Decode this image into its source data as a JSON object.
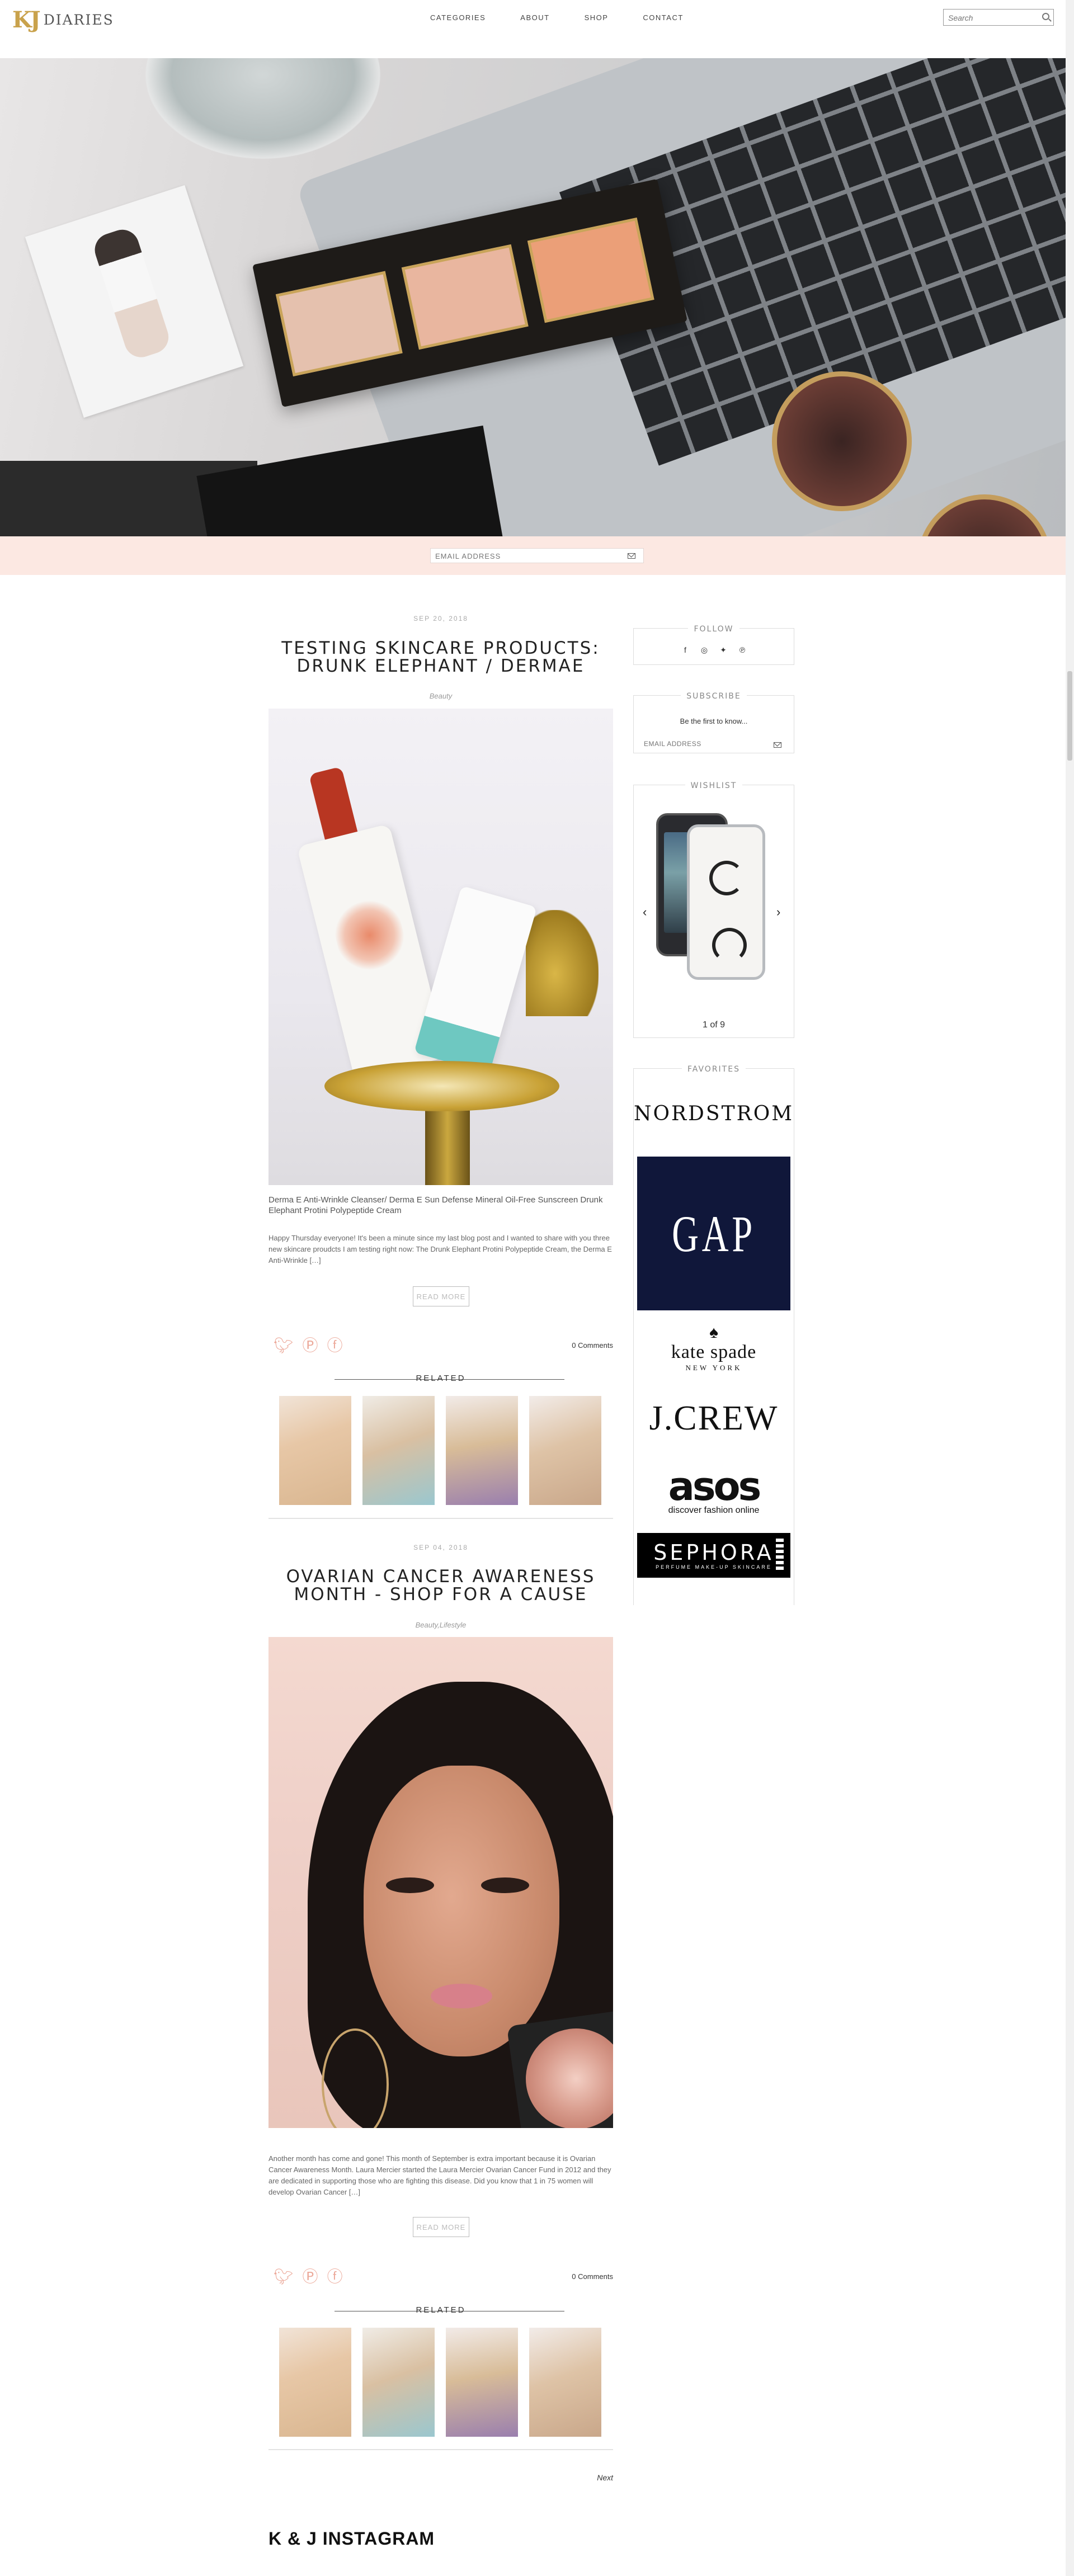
{
  "header": {
    "logo_mark": "KJ",
    "logo_text": "DIARIES",
    "nav": [
      "CATEGORIES",
      "ABOUT",
      "SHOP",
      "CONTACT"
    ],
    "search_placeholder": "Search"
  },
  "subscribe_band": {
    "placeholder": "EMAIL ADDRESS"
  },
  "posts": [
    {
      "date": "SEP 20, 2018",
      "title": "TESTING SKINCARE PRODUCTS: DRUNK ELEPHANT / DERMAE",
      "category": "Beauty",
      "caption": "Derma E Anti-Wrinkle Cleanser/ Derma E Sun Defense Mineral Oil-Free Sunscreen Drunk Elephant Protini Polypeptide Cream",
      "excerpt": "Happy Thursday everyone! It's been a minute since my last blog post and I wanted to share with you three new skincare proudcts I am testing right now: The Drunk Elephant Protini Polypeptide Cream, the Derma E Anti-Wrinkle […]",
      "read_more": "READ MORE",
      "comments": "0 Comments",
      "related_label": "RELATED"
    },
    {
      "date": "SEP 04, 2018",
      "title": "OVARIAN CANCER AWARENESS MONTH - SHOP FOR A CAUSE",
      "category": "Beauty,Lifestyle",
      "excerpt": "Another month has come and gone! This month of September is extra important because it is Ovarian Cancer Awareness Month. Laura Mercier started the Laura Mercier Ovarian Cancer Fund in 2012 and they are dedicated in supporting those who are fighting this disease. Did you know that 1 in 75 women will develop Ovarian Cancer […]",
      "read_more": "READ MORE",
      "comments": "0 Comments",
      "related_label": "RELATED"
    }
  ],
  "share_icons": [
    "twitter-icon",
    "pinterest-icon",
    "facebook-icon"
  ],
  "next_label": "Next",
  "instagram_title": "K & J INSTAGRAM",
  "sidebar": {
    "follow": {
      "title": "FOLLOW",
      "icons": [
        "facebook-icon",
        "instagram-icon",
        "twitter-icon",
        "pinterest-icon"
      ]
    },
    "subscribe": {
      "title": "SUBSCRIBE",
      "text": "Be the first to know...",
      "placeholder": "EMAIL ADDRESS"
    },
    "wishlist": {
      "title": "WISHLIST",
      "counter": "1 of 9"
    },
    "favorites": {
      "title": "FAVORITES",
      "brands": {
        "nordstrom": "NORDSTROM",
        "gap": "GAP",
        "kate_name": "kate spade",
        "kate_sub": "NEW YORK",
        "jcrew": "J.CREW",
        "asos_name": "asos",
        "asos_sub": "discover fashion online",
        "sephora_name": "SEPHORA",
        "sephora_sub": "PERFUME MAKE-UP SKINCARE"
      }
    }
  },
  "colors": {
    "band": "#fce8e2",
    "accent": "#eca99a",
    "logo_gold": "#c9a24c",
    "gap_navy": "#10173a"
  }
}
